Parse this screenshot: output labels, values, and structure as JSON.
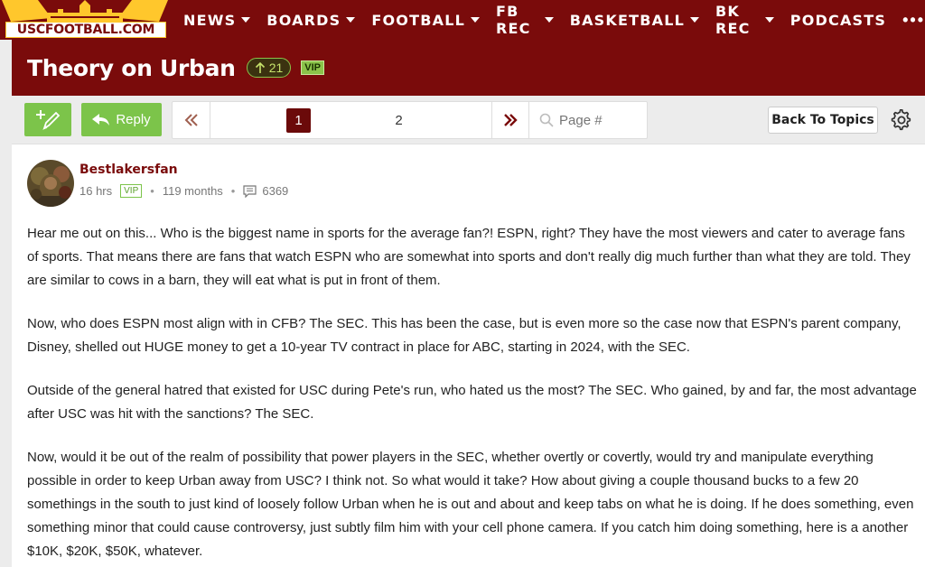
{
  "site": {
    "logo_text": "USCFOOTBALL.COM"
  },
  "nav": {
    "items": [
      {
        "label": "NEWS",
        "dropdown": true
      },
      {
        "label": "BOARDS",
        "dropdown": true
      },
      {
        "label": "FOOTBALL",
        "dropdown": true
      },
      {
        "label": "FB REC",
        "dropdown": true
      },
      {
        "label": "BASKETBALL",
        "dropdown": true
      },
      {
        "label": "BK REC",
        "dropdown": true
      },
      {
        "label": "PODCASTS",
        "dropdown": false
      }
    ],
    "more": "•••"
  },
  "topic": {
    "title": "Theory on Urban",
    "votes": "21",
    "badge": "VIP"
  },
  "toolbar": {
    "reply_label": "Reply",
    "pages": [
      "1",
      "2"
    ],
    "current_page": "1",
    "page_placeholder": "Page #",
    "back_label": "Back To Topics"
  },
  "post": {
    "author": "Bestlakersfan",
    "time": "16 hrs",
    "badge": "VIP",
    "tenure": "119 months",
    "post_count": "6369",
    "paragraphs": [
      "Hear me out on this... Who is the biggest name in sports for the average fan?! ESPN, right? They have the most viewers and cater to average fans of sports. That means there are fans that watch ESPN who are somewhat into sports and don't really dig much further than what they are told. They are similar to cows in a barn, they will eat what is put in front of them.",
      "Now, who does ESPN most align with in CFB? The SEC. This has been the case, but is even more so the case now that ESPN's parent company, Disney, shelled out HUGE money to get a 10-year TV contract in place for ABC, starting in 2024, with the SEC.",
      "Outside of the general hatred that existed for USC during Pete's run, who hated us the most? The SEC. Who gained, by and far, the most advantage after USC was hit with the sanctions? The SEC.",
      "Now, would it be out of the realm of possibility that power players in the SEC, whether overtly or covertly, would try and manipulate everything possible in order to keep Urban away from USC? I think not. So what would it take? How about giving a couple thousand bucks to a few 20 somethings in the south to just kind of loosely follow Urban when he is out and about and keep tabs on what he is doing. If he does something, even something minor that could cause controversy, just subtly film him with your cell phone camera. If you catch him doing something, here is a another $10K, $20K, $50K, whatever."
    ]
  },
  "colors": {
    "brand": "#7a0b0b",
    "accent_green": "#7cc44a",
    "gold": "#ffc72c"
  },
  "icons": {
    "new_topic": "pencil-plus-icon",
    "reply": "reply-arrow-icon",
    "first_page": "double-chevron-left-icon",
    "last_page": "double-chevron-right-icon",
    "search": "search-icon",
    "settings": "gear-icon",
    "posts": "comment-icon",
    "vote": "arrow-up-icon"
  }
}
